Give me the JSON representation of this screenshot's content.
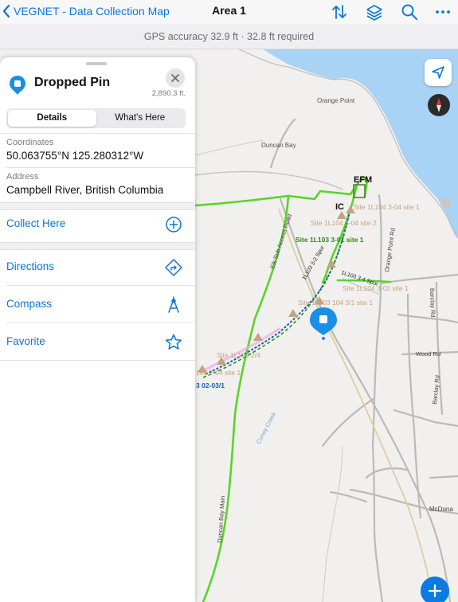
{
  "app": {
    "back_label": "VEGNET - Data Collection Map",
    "title": "Area 1"
  },
  "gps": {
    "accuracy_text": "GPS accuracy 32.9 ft  ·  32.8 ft required"
  },
  "panel": {
    "title": "Dropped Pin",
    "distance": "2,890.3 ft.",
    "tabs": [
      "Details",
      "What's Here"
    ],
    "active_tab": "Details",
    "coordinates_label": "Coordinates",
    "coordinates_value": "50.063755°N  125.280312°W",
    "address_label": "Address",
    "address_value": "Campbell River, British Columbia",
    "collect_label": "Collect Here",
    "actions": [
      "Directions",
      "Compass",
      "Favorite"
    ]
  },
  "map": {
    "places": {
      "orange_point": "Orange Point",
      "duncan_bay": "Duncan Bay",
      "coney_creek": "Coney Creek"
    },
    "roads": {
      "elk_sub": "Elk Sub Access Road",
      "orange_point_rd": "Orange Point Rd",
      "barclay_rd_1": "Barclay Rd",
      "barclay_rd_2": "Barclay Rd",
      "wood_rd": "Wood Rd",
      "duncan_bay_main": "Duncan Bay Main",
      "mcdona": "McDona",
      "spur_32": "1L103 3-2 Spur",
      "spur_34": "1L103 3-4 Spur"
    },
    "sites": {
      "efm": "EFM",
      "ic": "IC",
      "s1": "Site 1L104 3-04 site 1",
      "s2": "Site 1L104 3-04 site 2",
      "s3": "Site 1L103 3-01 site 1",
      "s4": "Site 1L104 3-02 site 1",
      "s5": "Site 1L103 104 3/1 site 1",
      "s6": "Site 1L103 2/4",
      "s7": "103 2-04 site 1",
      "s8": "3 02-03/1"
    },
    "colors": {
      "water": "#a9d3f5",
      "land": "#f1f0ee",
      "trail": "#59d42a",
      "road": "#b9b9b9",
      "site": "#c4a37d",
      "accent": "#1a8fe8"
    }
  }
}
